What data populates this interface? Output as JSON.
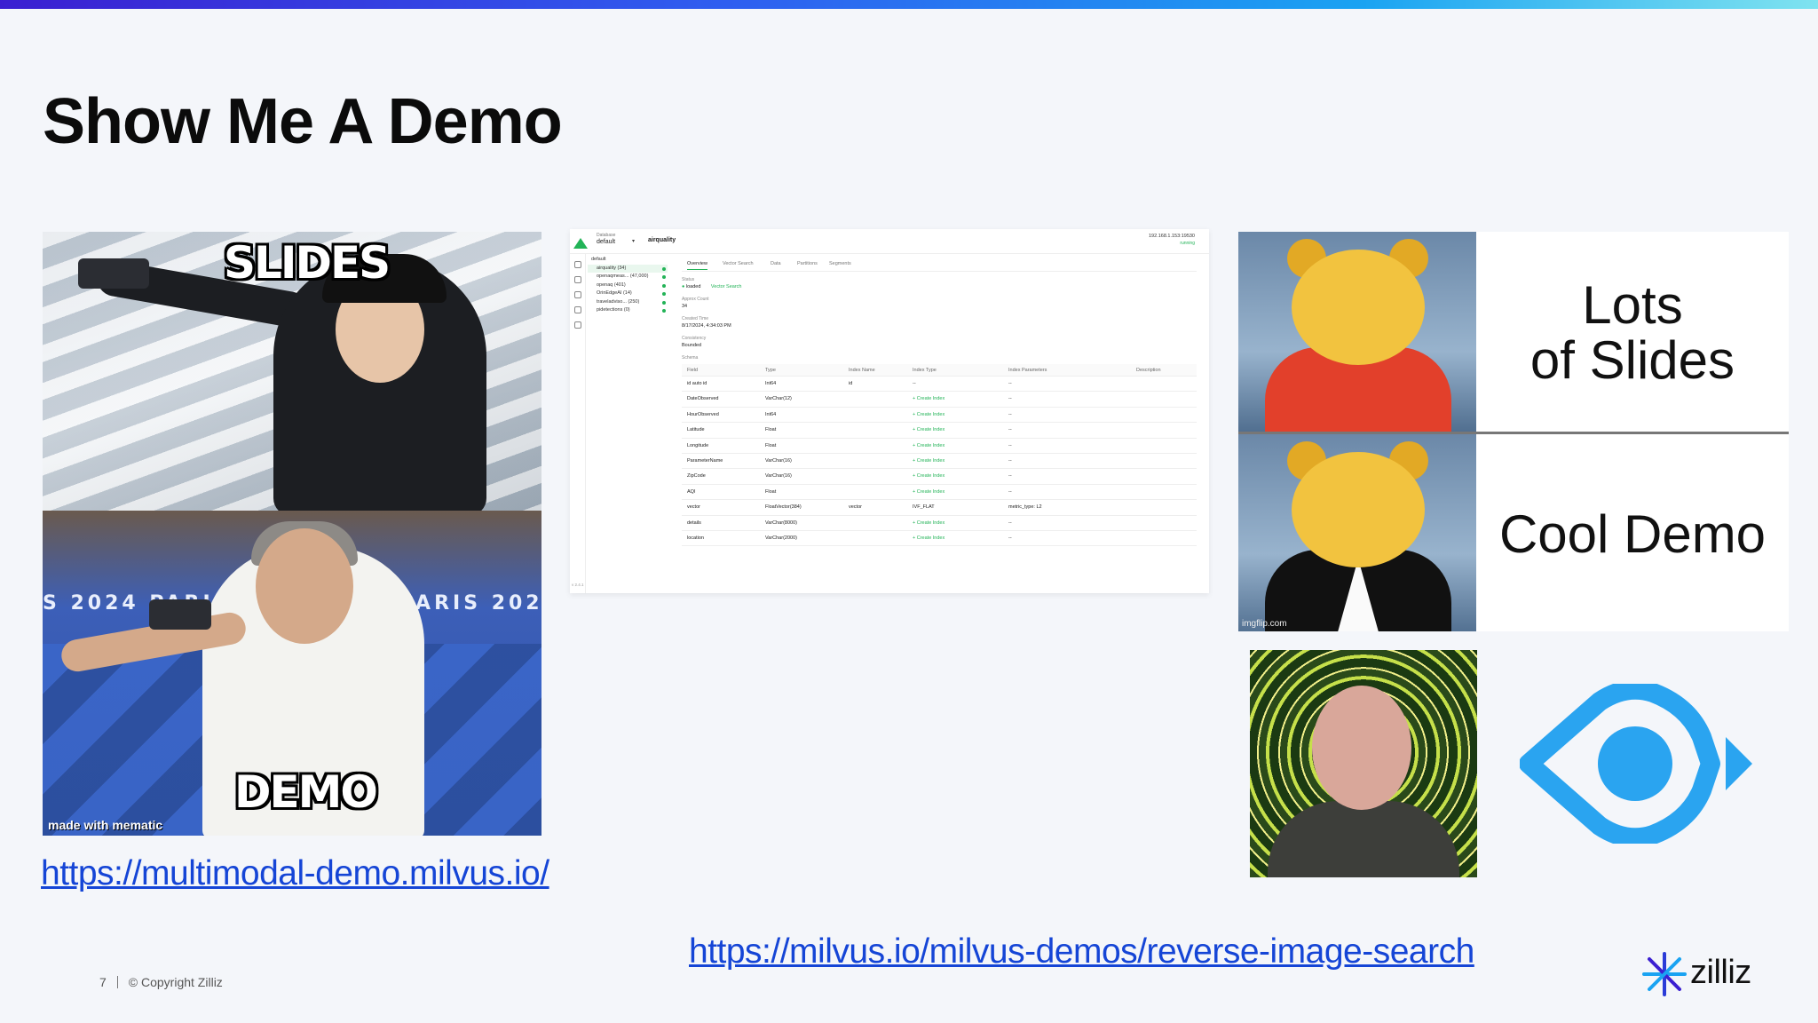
{
  "slide": {
    "title": "Show Me A Demo",
    "page_number": "7",
    "copyright": "© Copyright Zilliz",
    "brand": "zilliz",
    "accent_gradient": [
      "#3b1fd1",
      "#2f5ef0",
      "#1aa3f2",
      "#7fe3f0"
    ],
    "link_color": "#1545d6"
  },
  "meme_left": {
    "top_label": "SLIDES",
    "bottom_label": "DEMO",
    "banner_text": "S 2024  PARIS 2024  2024  PARIS 202",
    "watermark": "made with mematic"
  },
  "links": {
    "multimodal": "https://multimodal-demo.milvus.io/",
    "reverse_image": "https://milvus.io/milvus-demos/reverse-image-search"
  },
  "attu": {
    "database_label": "Database",
    "database_value": "default",
    "collection": "airquality",
    "server_ip": "192.168.1.153:19530",
    "server_status": "running",
    "version": "v 2.4.1",
    "tree": [
      {
        "label": "default",
        "root": true
      },
      {
        "label": "airquality (34)",
        "active": true
      },
      {
        "label": "openaqmeas... (47,000)"
      },
      {
        "label": "openaq (401)"
      },
      {
        "label": "OrinEdgeAI (14)"
      },
      {
        "label": "traveladviso... (250)"
      },
      {
        "label": "pidetections (0)"
      }
    ],
    "tabs": [
      "Overview",
      "Vector Search",
      "Data",
      "Partitions",
      "Segments"
    ],
    "status_label": "Status",
    "status_value": "loaded",
    "vector_search_link": "Vector Search",
    "approx_count_label": "Approx Count",
    "approx_count_value": "34",
    "created_time_label": "Created Time",
    "created_time_value": "8/17/2024, 4:34:03 PM",
    "consistency_label": "Consistency",
    "consistency_value": "Bounded",
    "schema_label": "Schema",
    "columns": [
      "Field",
      "Type",
      "Index Name",
      "Index Type",
      "Index Parameters",
      "Description"
    ],
    "rows": [
      {
        "field": "id  auto id",
        "type": "Int64",
        "index_name": "id",
        "index_type": "--",
        "params": "--",
        "desc": ""
      },
      {
        "field": "DateObserved",
        "type": "VarChar(12)",
        "index_name": "",
        "index_type": "+ Create Index",
        "params": "--",
        "desc": ""
      },
      {
        "field": "HourObserved",
        "type": "Int64",
        "index_name": "",
        "index_type": "+ Create Index",
        "params": "--",
        "desc": ""
      },
      {
        "field": "Latitude",
        "type": "Float",
        "index_name": "",
        "index_type": "+ Create Index",
        "params": "--",
        "desc": ""
      },
      {
        "field": "Longitude",
        "type": "Float",
        "index_name": "",
        "index_type": "+ Create Index",
        "params": "--",
        "desc": ""
      },
      {
        "field": "ParameterName",
        "type": "VarChar(16)",
        "index_name": "",
        "index_type": "+ Create Index",
        "params": "--",
        "desc": ""
      },
      {
        "field": "ZipCode",
        "type": "VarChar(16)",
        "index_name": "",
        "index_type": "+ Create Index",
        "params": "--",
        "desc": ""
      },
      {
        "field": "AQI",
        "type": "Float",
        "index_name": "",
        "index_type": "+ Create Index",
        "params": "--",
        "desc": ""
      },
      {
        "field": "vector",
        "type": "FloatVector(384)",
        "index_name": "vector",
        "index_type": "IVF_FLAT",
        "params": "metric_type: L2",
        "desc": ""
      },
      {
        "field": "details",
        "type": "VarChar(8000)",
        "index_name": "",
        "index_type": "+ Create Index",
        "params": "--",
        "desc": ""
      },
      {
        "field": "location",
        "type": "VarChar(2000)",
        "index_name": "",
        "index_type": "+ Create Index",
        "params": "--",
        "desc": ""
      }
    ]
  },
  "pooh_meme": {
    "top_text_line1": "Lots",
    "top_text_line2": "of Slides",
    "bottom_text": "Cool Demo",
    "watermark": "imgflip.com"
  },
  "eye_logo": {
    "color": "#2aa4f0",
    "icon": "eye-icon"
  }
}
